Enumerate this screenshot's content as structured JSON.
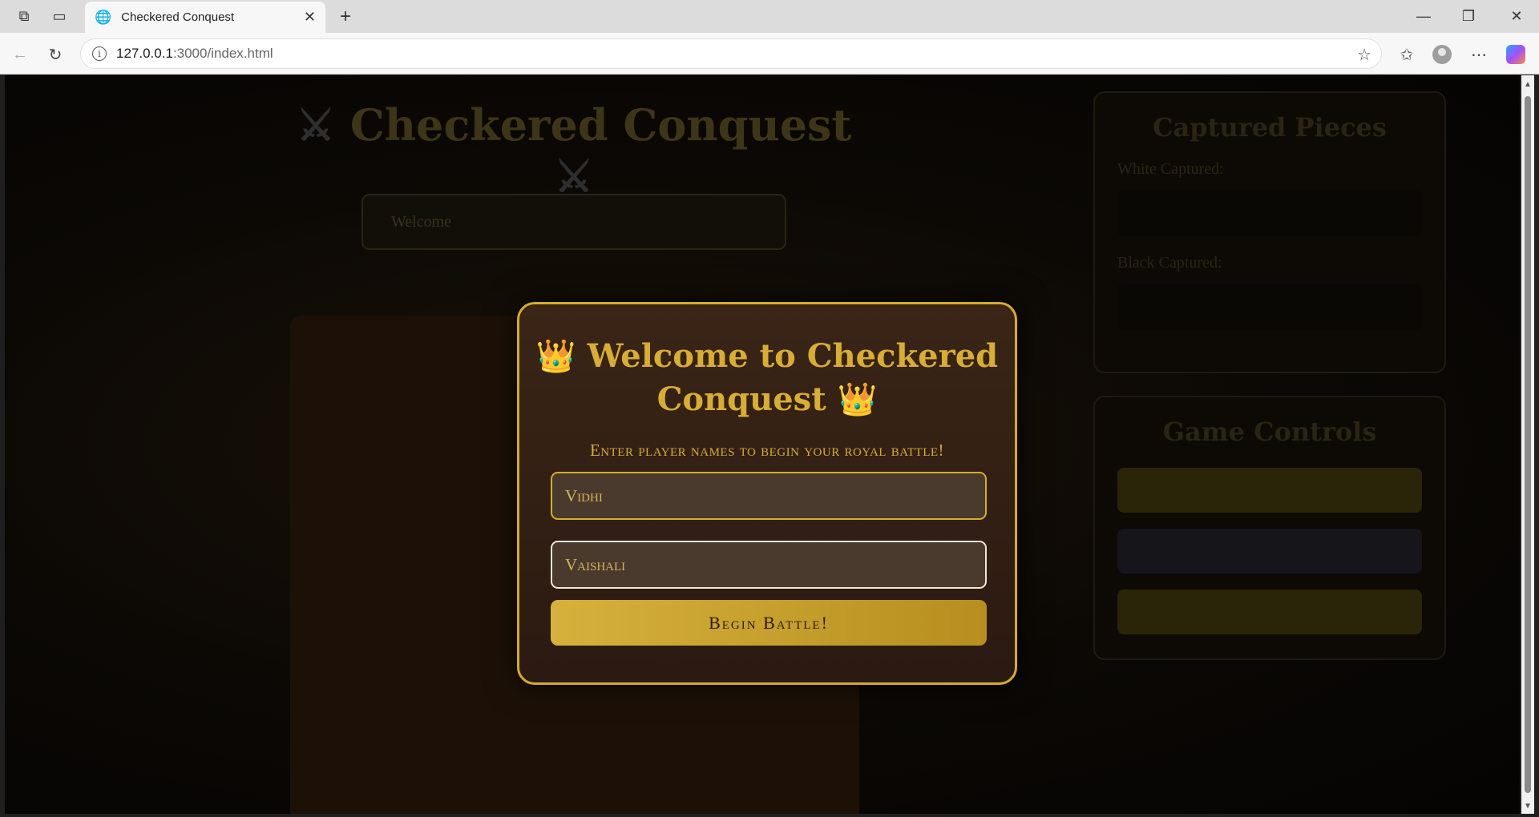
{
  "browser": {
    "tab_title": "Checkered Conquest",
    "url_host": "127.0.0.1",
    "url_path": ":3000/index.html"
  },
  "background": {
    "title": "Checkered Conquest",
    "title_icon": "crossed-swords",
    "status_text": "Welcome",
    "captured_title": "Captured Pieces",
    "white_captured_label": "White Captured:",
    "black_captured_label": "Black Captured:",
    "controls_title": "Game Controls"
  },
  "modal": {
    "title": "Welcome to Checkered Conquest",
    "title_icon": "crown",
    "subtitle": "Enter player names to begin your royal battle!",
    "player1_value": "Vidhi",
    "player2_value": "Vaishali",
    "begin_label": "Begin Battle!"
  },
  "colors": {
    "accent_gold": "#d4ac2f",
    "modal_bg": "#3a2516"
  }
}
